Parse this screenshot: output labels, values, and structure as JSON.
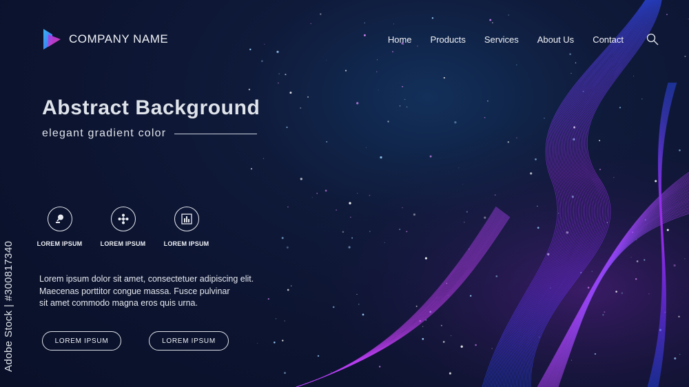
{
  "header": {
    "company_name": "COMPANY NAME",
    "nav": [
      "Home",
      "Products",
      "Services",
      "About Us",
      "Contact"
    ]
  },
  "hero": {
    "title": "Abstract Background",
    "subtitle": "elegant gradient color"
  },
  "features": [
    {
      "label": "LOREM IPSUM",
      "icon": "lightbulb-icon"
    },
    {
      "label": "LOREM IPSUM",
      "icon": "network-icon"
    },
    {
      "label": "LOREM IPSUM",
      "icon": "bar-chart-icon"
    }
  ],
  "body_lines": [
    "Lorem ipsum dolor sit amet, consectetuer adipiscing elit.",
    "Maecenas porttitor congue massa. Fusce pulvinar",
    "sit amet commodo magna eros quis urna."
  ],
  "buttons": [
    "LOREM IPSUM",
    "LOREM IPSUM"
  ],
  "watermark": "Adobe Stock | #300817340",
  "colors": {
    "background": "#0c1430",
    "wave_purple": "#b92cf0",
    "wave_blue": "#2e5bff",
    "text": "#e9ecf5"
  }
}
